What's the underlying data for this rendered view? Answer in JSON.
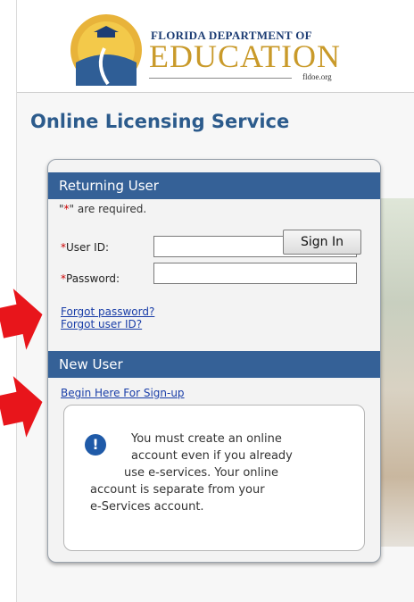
{
  "header": {
    "dept_name": "FLORIDA DEPARTMENT OF",
    "edu_word": "EDUCATION",
    "site_url": "fldoe.org"
  },
  "service_title": "Online Licensing Service",
  "returning": {
    "heading": "Returning User",
    "required_note_pre": "\"",
    "required_star": "*",
    "required_note_post": "\" are required.",
    "user_id_star": "*",
    "user_id_label": "User ID:",
    "user_id_value": "",
    "password_star": "*",
    "password_label": "Password:",
    "password_value": "",
    "forgot_password": "Forgot password?",
    "forgot_user_id": "Forgot user ID?",
    "sign_in": "Sign In"
  },
  "new_user": {
    "heading": "New User",
    "begin_link": "Begin Here For Sign-up",
    "info_icon": "!",
    "info_lines": [
      "You must create an online",
      "account even if you already",
      "use e-services. Your online",
      "account is separate from your",
      "e-Services account."
    ]
  },
  "colors": {
    "header_bar": "#356197",
    "title_blue": "#2c5b8c",
    "arrow_red": "#e8151b",
    "link_blue": "#1a3ea8",
    "edu_gold": "#c99a2a"
  }
}
